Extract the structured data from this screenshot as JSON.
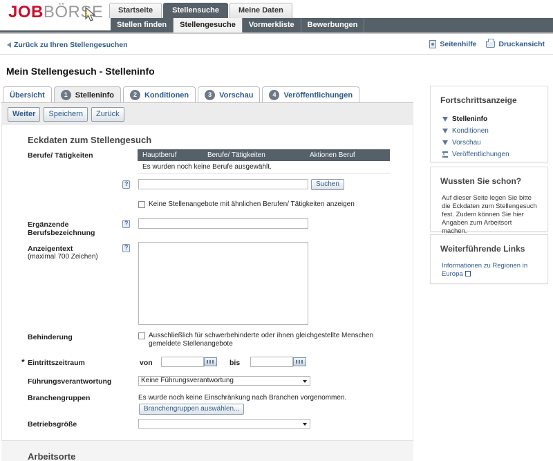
{
  "header": {
    "logo_red": "JOB",
    "logo_gray": "BÖRSE",
    "top_tabs": [
      {
        "label": "Startseite",
        "active": false
      },
      {
        "label": "Stellensuche",
        "active": true
      },
      {
        "label": "Meine Daten",
        "active": false
      }
    ],
    "sub_tabs": [
      {
        "label": "Stellen finden",
        "active": false
      },
      {
        "label": "Stellengesuche",
        "active": true
      },
      {
        "label": "Vormerkliste",
        "active": false
      },
      {
        "label": "Bewerbungen",
        "active": false
      }
    ]
  },
  "crumbbar": {
    "back_label": "Zurück zu Ihren Stellengesuchen",
    "help_label": "Seitenhilfe",
    "print_label": "Druckansicht"
  },
  "page_title": "Mein Stellengesuch - Stelleninfo",
  "step_tabs": [
    {
      "num": "",
      "label": "Übersicht",
      "active": false
    },
    {
      "num": "1",
      "label": "Stelleninfo",
      "active": true
    },
    {
      "num": "2",
      "label": "Konditionen",
      "active": false
    },
    {
      "num": "3",
      "label": "Vorschau",
      "active": false
    },
    {
      "num": "4",
      "label": "Veröffentlichungen",
      "active": false
    }
  ],
  "actions": {
    "next": "Weiter",
    "save": "Speichern",
    "back": "Zurück"
  },
  "form": {
    "section_title": "Eckdaten zum Stellengesuch",
    "berufe_label": "Berufe/ Tätigkeiten",
    "table_headers": [
      "Hauptberuf",
      "Berufe/ Tätigkeiten",
      "Aktionen Beruf"
    ],
    "table_empty": "Es wurden noch keine Berufe ausgewählt.",
    "beruf_input_value": "",
    "search_button": "Suchen",
    "similar_checkbox_label": "Keine Stellenangebote mit ähnlichen Berufen/ Tätigkeiten anzeigen",
    "similar_checked": false,
    "ergaenzende_label_1": "Ergänzende",
    "ergaenzende_label_2": "Berufsbezeichnung",
    "ergaenzende_value": "",
    "anzeigentext_label": "Anzeigentext",
    "anzeigentext_sub": "(maximal 700 Zeichen)",
    "anzeigentext_value": "",
    "behinderung_label": "Behinderung",
    "behinderung_checkbox_line1": "Ausschließlich für schwerbehinderte oder ihnen gleichgestellte Menschen",
    "behinderung_checkbox_line2": "gemeldete Stellenangebote",
    "behinderung_checked": false,
    "required_mark": "*",
    "eintritt_label": "Eintrittszeitraum",
    "von_label": "von",
    "bis_label": "bis",
    "von_value": "",
    "bis_value": "",
    "fuehrung_label": "Führungsverantwortung",
    "fuehrung_selected": "Keine Führungsverantwortung",
    "branchen_label": "Branchengruppen",
    "branchen_text": "Es wurde noch keine Einschränkung nach Branchen vorgenommen.",
    "branchen_button": "Branchengruppen auswählen...",
    "betrieb_label": "Betriebsgröße",
    "betrieb_selected": "",
    "next_section_title": "Arbeitsorte"
  },
  "sidebar": {
    "progress_title": "Fortschrittsanzeige",
    "progress_items": [
      "Stelleninfo",
      "Konditionen",
      "Vorschau",
      "Veröffentlichungen"
    ],
    "tips_title": "Wussten Sie schon?",
    "tips_text": "Auf dieser Seite legen Sie bitte die Eckdaten zum Stellengesuch fest. Zudem können Sie hier Angaben zum Arbeitsort machen.",
    "links_title": "Weiterführende Links",
    "link_text": "Informationen zu Regionen in Europa"
  },
  "colors": {
    "brand_red": "#c8102e",
    "nav_dark": "#566069",
    "link_blue": "#2e5a8a"
  }
}
